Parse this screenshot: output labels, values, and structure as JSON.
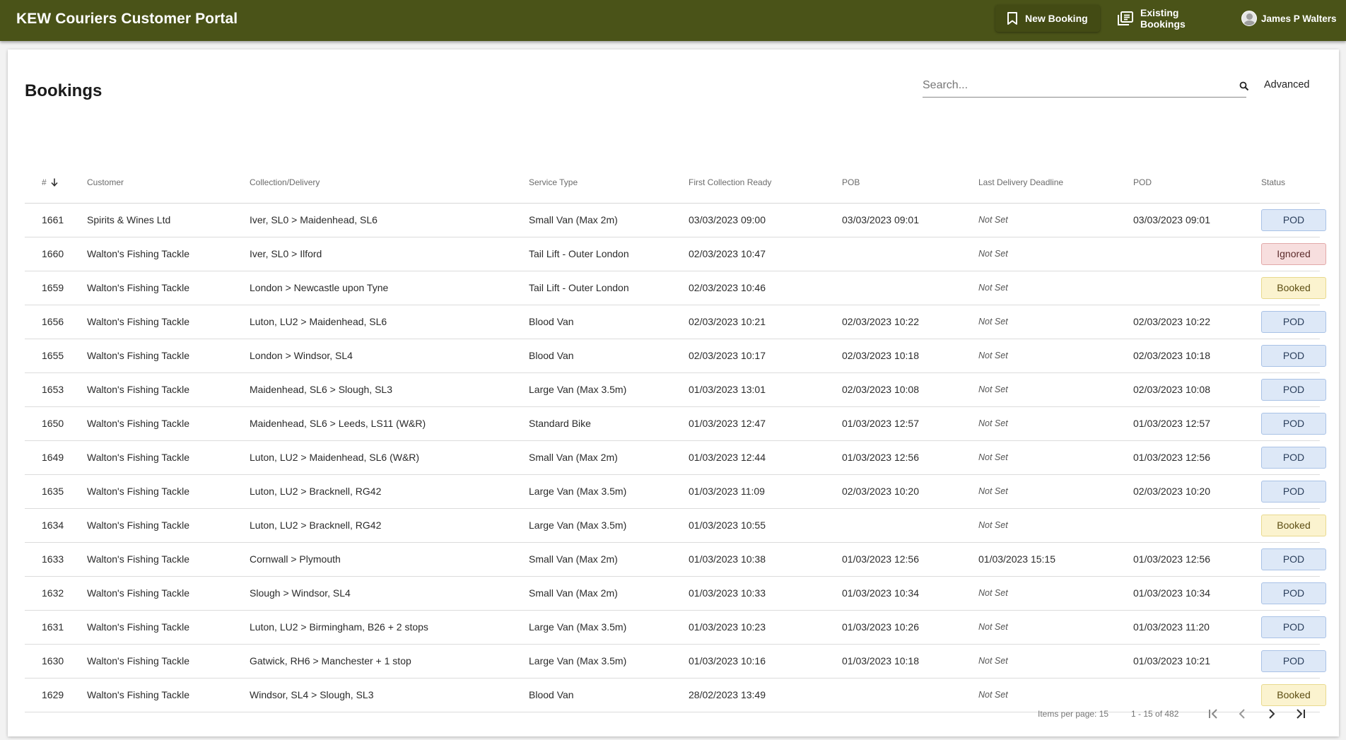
{
  "app": {
    "title": "KEW Couriers Customer Portal"
  },
  "nav": {
    "new_booking": "New Booking",
    "existing_bookings": "Existing Bookings",
    "user_name": "James P Walters"
  },
  "page": {
    "title": "Bookings",
    "search_placeholder": "Search...",
    "advanced_label": "Advanced"
  },
  "table": {
    "headers": {
      "id": "#",
      "customer": "Customer",
      "collection_delivery": "Collection/Delivery",
      "service_type": "Service Type",
      "first_collection_ready": "First Collection Ready",
      "pob": "POB",
      "last_delivery_deadline": "Last Delivery Deadline",
      "pod": "POD",
      "status": "Status"
    },
    "sort": {
      "column": "#",
      "direction": "descending"
    },
    "rows": [
      {
        "id": "1661",
        "customer": "Spirits & Wines Ltd",
        "route": "Iver, SL0 > Maidenhead, SL6",
        "service": "Small Van (Max 2m)",
        "fcr": "03/03/2023 09:00",
        "pob": "03/03/2023 09:01",
        "ldd": "Not Set",
        "pod": "03/03/2023 09:01",
        "status": "POD"
      },
      {
        "id": "1660",
        "customer": "Walton's Fishing Tackle",
        "route": "Iver, SL0 > Ilford",
        "service": "Tail Lift - Outer London",
        "fcr": "02/03/2023 10:47",
        "pob": "",
        "ldd": "Not Set",
        "pod": "",
        "status": "Ignored"
      },
      {
        "id": "1659",
        "customer": "Walton's Fishing Tackle",
        "route": "London > Newcastle upon Tyne",
        "service": "Tail Lift - Outer London",
        "fcr": "02/03/2023 10:46",
        "pob": "",
        "ldd": "Not Set",
        "pod": "",
        "status": "Booked"
      },
      {
        "id": "1656",
        "customer": "Walton's Fishing Tackle",
        "route": "Luton, LU2 > Maidenhead, SL6",
        "service": "Blood Van",
        "fcr": "02/03/2023 10:21",
        "pob": "02/03/2023 10:22",
        "ldd": "Not Set",
        "pod": "02/03/2023 10:22",
        "status": "POD"
      },
      {
        "id": "1655",
        "customer": "Walton's Fishing Tackle",
        "route": "London > Windsor, SL4",
        "service": "Blood Van",
        "fcr": "02/03/2023 10:17",
        "pob": "02/03/2023 10:18",
        "ldd": "Not Set",
        "pod": "02/03/2023 10:18",
        "status": "POD"
      },
      {
        "id": "1653",
        "customer": "Walton's Fishing Tackle",
        "route": "Maidenhead, SL6 > Slough, SL3",
        "service": "Large Van (Max 3.5m)",
        "fcr": "01/03/2023 13:01",
        "pob": "02/03/2023 10:08",
        "ldd": "Not Set",
        "pod": "02/03/2023 10:08",
        "status": "POD"
      },
      {
        "id": "1650",
        "customer": "Walton's Fishing Tackle",
        "route": "Maidenhead, SL6 > Leeds, LS11 (W&R)",
        "service": "Standard Bike",
        "fcr": "01/03/2023 12:47",
        "pob": "01/03/2023 12:57",
        "ldd": "Not Set",
        "pod": "01/03/2023 12:57",
        "status": "POD"
      },
      {
        "id": "1649",
        "customer": "Walton's Fishing Tackle",
        "route": "Luton, LU2 > Maidenhead, SL6 (W&R)",
        "service": "Small Van (Max 2m)",
        "fcr": "01/03/2023 12:44",
        "pob": "01/03/2023 12:56",
        "ldd": "Not Set",
        "pod": "01/03/2023 12:56",
        "status": "POD"
      },
      {
        "id": "1635",
        "customer": "Walton's Fishing Tackle",
        "route": "Luton, LU2 > Bracknell, RG42",
        "service": "Large Van (Max 3.5m)",
        "fcr": "01/03/2023 11:09",
        "pob": "02/03/2023 10:20",
        "ldd": "Not Set",
        "pod": "02/03/2023 10:20",
        "status": "POD"
      },
      {
        "id": "1634",
        "customer": "Walton's Fishing Tackle",
        "route": "Luton, LU2 > Bracknell, RG42",
        "service": "Large Van (Max 3.5m)",
        "fcr": "01/03/2023 10:55",
        "pob": "",
        "ldd": "Not Set",
        "pod": "",
        "status": "Booked"
      },
      {
        "id": "1633",
        "customer": "Walton's Fishing Tackle",
        "route": "Cornwall > Plymouth",
        "service": "Small Van (Max 2m)",
        "fcr": "01/03/2023 10:38",
        "pob": "01/03/2023 12:56",
        "ldd": "01/03/2023 15:15",
        "pod": "01/03/2023 12:56",
        "status": "POD"
      },
      {
        "id": "1632",
        "customer": "Walton's Fishing Tackle",
        "route": "Slough > Windsor, SL4",
        "service": "Small Van (Max 2m)",
        "fcr": "01/03/2023 10:33",
        "pob": "01/03/2023 10:34",
        "ldd": "Not Set",
        "pod": "01/03/2023 10:34",
        "status": "POD"
      },
      {
        "id": "1631",
        "customer": "Walton's Fishing Tackle",
        "route": "Luton, LU2 > Birmingham, B26 + 2 stops",
        "service": "Large Van (Max 3.5m)",
        "fcr": "01/03/2023 10:23",
        "pob": "01/03/2023 10:26",
        "ldd": "Not Set",
        "pod": "01/03/2023 11:20",
        "status": "POD"
      },
      {
        "id": "1630",
        "customer": "Walton's Fishing Tackle",
        "route": "Gatwick, RH6 > Manchester + 1 stop",
        "service": "Large Van (Max 3.5m)",
        "fcr": "01/03/2023 10:16",
        "pob": "01/03/2023 10:18",
        "ldd": "Not Set",
        "pod": "01/03/2023 10:21",
        "status": "POD"
      },
      {
        "id": "1629",
        "customer": "Walton's Fishing Tackle",
        "route": "Windsor, SL4 > Slough, SL3",
        "service": "Blood Van",
        "fcr": "28/02/2023 13:49",
        "pob": "",
        "ldd": "Not Set",
        "pod": "",
        "status": "Booked"
      }
    ]
  },
  "status_styles": {
    "POD": {
      "bg": "#dde8f7",
      "border": "#a9c2e6",
      "color": "#2b3f5c"
    },
    "Ignored": {
      "bg": "#f7dede",
      "border": "#e2a9a9",
      "color": "#5c2b2b"
    },
    "Booked": {
      "bg": "#fbf3cf",
      "border": "#e8d98e",
      "color": "#5c4d12"
    }
  },
  "paginator": {
    "items_per_page_label": "Items per page: 15",
    "range_label": "1 - 15 of 482"
  },
  "colors": {
    "topbar": "#4a5318",
    "accent_dark": "#434b14"
  }
}
